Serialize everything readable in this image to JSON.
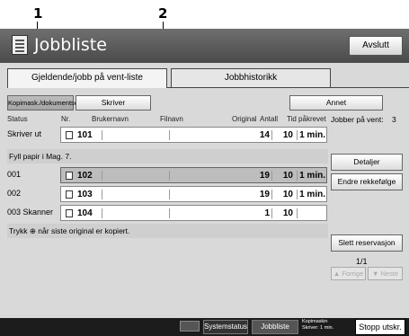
{
  "callouts": {
    "one": "1",
    "two": "2"
  },
  "title": "Jobbliste",
  "exit_label": "Avslutt",
  "tabs": [
    {
      "label": "Gjeldende/jobb på vent-liste"
    },
    {
      "label": "Jobbhistorikk"
    }
  ],
  "filters": {
    "copier": "Kopimask./dokumentserver",
    "printer": "Skriver",
    "other": "Annet"
  },
  "headers": {
    "status": "Status",
    "nr": "Nr.",
    "user": "Brukernavn",
    "file": "Filnavn",
    "original": "Original",
    "count": "Antall",
    "time": "Tid påkrevet"
  },
  "jobs_waiting_label": "Jobber på vent:",
  "jobs_waiting_count": "3",
  "rows": [
    {
      "status": "Skriver ut",
      "nr": "101",
      "original": "14",
      "count": "10",
      "time": "1 min."
    },
    {
      "status": "001",
      "nr": "102",
      "original": "19",
      "count": "10",
      "time": "1 min."
    },
    {
      "status": "002",
      "nr": "103",
      "original": "19",
      "count": "10",
      "time": "1 min."
    },
    {
      "status": "003 Skanner",
      "nr": "104",
      "original": "1",
      "count": "10",
      "time": ""
    }
  ],
  "strip_messages": {
    "paper": "Fyll papir i Mag. 7.",
    "scan": "Trykk ⊕ når siste original er kopiert."
  },
  "actions": {
    "details": "Detaljer",
    "reorder": "Endre rekkefølge",
    "delete_reservation": "Slett reservasjon",
    "page": "1/1",
    "prev": "▲ Forrige",
    "next": "▼ Neste"
  },
  "bottom": {
    "system_status": "Systemstatus",
    "job_list": "Jobbliste",
    "status_line1": "Kopimaskin",
    "status_line2": "Skriver: 1 min.",
    "stop": "Stopp utskr."
  },
  "colors": {
    "title_bar": "#4a4a4a",
    "screen_bg": "#d9d9d9",
    "selected_row": "#bdbdbd",
    "bottom_bar": "#1c1c1c"
  }
}
